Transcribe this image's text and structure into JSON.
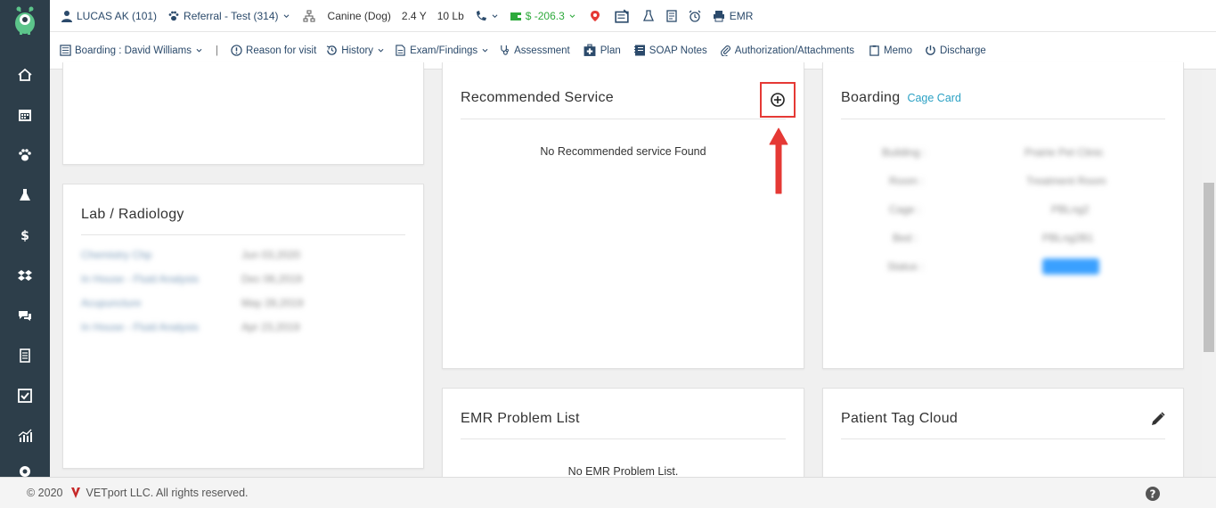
{
  "header": {
    "client": "LUCAS AK (101)",
    "referral": "Referral - Test (314)",
    "species": "Canine (Dog)",
    "age": "2.4 Y",
    "weight": "10 Lb",
    "balance": "$ -206.3",
    "emr_label": "EMR"
  },
  "menu": {
    "boarding": "Boarding : David Williams",
    "separator": "|",
    "reason": "Reason for visit",
    "history": "History",
    "exam": "Exam/Findings",
    "assessment": "Assessment",
    "plan": "Plan",
    "soap": "SOAP Notes",
    "authorization": "Authorization/Attachments",
    "memo": "Memo",
    "discharge": "Discharge"
  },
  "lab": {
    "title": "Lab / Radiology",
    "rows": [
      {
        "name": "Chemistry Chp",
        "date": "Jun 03,2020"
      },
      {
        "name": "In House - Fluid Analysis",
        "date": "Dec 06,2019"
      },
      {
        "name": "Acupuncture",
        "date": "May 28,2019"
      },
      {
        "name": "In House - Fluid Analysis",
        "date": "Apr 23,2019"
      }
    ]
  },
  "recommended": {
    "title": "Recommended Service",
    "empty": "No Recommended service Found"
  },
  "boarding": {
    "title": "Boarding",
    "cage_link": "Cage Card",
    "rows": [
      {
        "label": "Building :",
        "value": "Prairie Pet Clinic"
      },
      {
        "label": "Room :",
        "value": "Treatment Room"
      },
      {
        "label": "Cage :",
        "value": "PBLng2"
      },
      {
        "label": "Bed :",
        "value": "PBLng2B1"
      },
      {
        "label": "Status :",
        "value": ""
      }
    ]
  },
  "emr_problem": {
    "title": "EMR Problem List",
    "empty": "No EMR Problem List."
  },
  "tag_cloud": {
    "title": "Patient Tag Cloud"
  },
  "footer": {
    "copyright": "© 2020",
    "company": "VETport LLC. All rights reserved."
  },
  "colors": {
    "sidebar": "#2d3e4a",
    "accent": "#2ba1c4",
    "highlight": "#e53935",
    "balance": "#2eaa3c"
  }
}
